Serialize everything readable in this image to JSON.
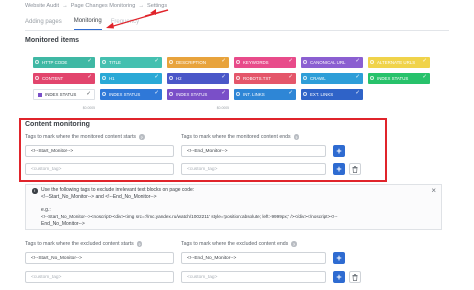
{
  "breadcrumb": [
    "Website Audit",
    "Page Changes Monitoring",
    "Settings"
  ],
  "tabs": [
    {
      "label": "Adding pages"
    },
    {
      "label": "Monitoring"
    },
    {
      "label": "Frequency"
    }
  ],
  "monitored_items": {
    "title": "Monitored items",
    "chips": [
      {
        "label": "HTTP CODE",
        "color": "#3fb8a4"
      },
      {
        "label": "TITLE",
        "color": "#44c0b0"
      },
      {
        "label": "DESCRIPTION",
        "color": "#e8a33c"
      },
      {
        "label": "KEYWORDS",
        "color": "#e84b8a"
      },
      {
        "label": "CANONICAL URL",
        "color": "#8b5fd1"
      },
      {
        "label": "ALTERNATE URLS",
        "color": "#f0d34a"
      },
      {
        "label": "CONTENT",
        "color": "#e2456d"
      },
      {
        "label": "H1",
        "color": "#2aa9d6"
      },
      {
        "label": "H2",
        "color": "#4a57c8"
      },
      {
        "label": "ROBOTS.TXT",
        "color": "#e4566a"
      },
      {
        "label": "CRAWL",
        "color": "#2e9ed8"
      },
      {
        "label": "INDEX STATUS",
        "color": "#27c26b"
      },
      {
        "label": "INDEX STATUS",
        "color": "#ffffff"
      },
      {
        "label": "INDEX STATUS",
        "color": "#2f78d8"
      },
      {
        "label": "INDEX STATUS",
        "color": "#7a4fc8"
      },
      {
        "label": "INT. LINKS",
        "color": "#2e86d6"
      },
      {
        "label": "EXT. LINKS",
        "color": "#2f63c8"
      }
    ],
    "subtexts": [
      "$0.0005",
      "",
      "$0.0005",
      "",
      "",
      ""
    ]
  },
  "content_monitoring": {
    "title": "Content monitoring",
    "start_label": "Tags to mark where the monitored content starts",
    "end_label": "Tags to mark where the monitored content ends",
    "start_value": "<!--Start_Monitor-->",
    "end_value": "<!--End_Monitor-->",
    "custom_placeholder": "<custom_tag>"
  },
  "info": {
    "line1": "Use the following tags to exclude irrelevant text blocks on page code:",
    "line2": "<!--Start_No_Monitor--> and <!--End_No_Monitor-->",
    "line3": "e.g.:",
    "line4": "<!--Start_No_Monitor--><noscript><div><img src='//mc.yandex.ru/watch/1002211' style='position:absolute; left:-9999px;' /></div></noscript><!--",
    "line5": "End_No_Monitor-->"
  },
  "excluded": {
    "start_label": "Tags to mark where the excluded content starts",
    "end_label": "Tags to mark where the excluded content ends",
    "start_value": "<!--Start_No_Monitor-->",
    "end_value": "<!--End_No_Monitor-->",
    "custom_placeholder": "<custom_tag>"
  }
}
